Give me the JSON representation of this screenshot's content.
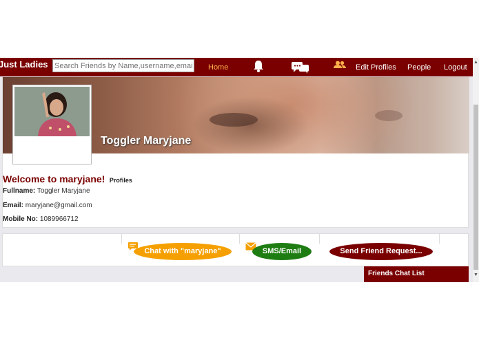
{
  "navbar": {
    "brand": "Just Ladies",
    "search_placeholder": "Search Friends by Name,username,email,phone",
    "home_label": "Home",
    "edit_profiles_label": "Edit Profiles",
    "people_label": "People",
    "logout_label": "Logout",
    "icons": [
      "bell-icon",
      "chat-bubbles-icon",
      "friends-icon"
    ]
  },
  "profile": {
    "cover_name": "Toggler Maryjane",
    "welcome": "Welcome to maryjane!",
    "welcome_sub": "Profiles",
    "fullname_label": "Fullname:",
    "fullname": "Toggler Maryjane",
    "email_label": "Email:",
    "email": "maryjane@gmail.com",
    "mobile_label": "Mobile No:",
    "mobile": "1089966712"
  },
  "actions": {
    "chat_label": "Chat with \"maryjane\"",
    "sms_label": "SMS/Email",
    "friend_label": "Send Friend Request..."
  },
  "chat_list": {
    "title": "Friends Chat List"
  },
  "colors": {
    "brand": "#7a0000",
    "home_active": "#ffb24d",
    "chat_button": "#f5a000",
    "sms_button": "#1e7d12",
    "friend_button": "#7a0000"
  }
}
